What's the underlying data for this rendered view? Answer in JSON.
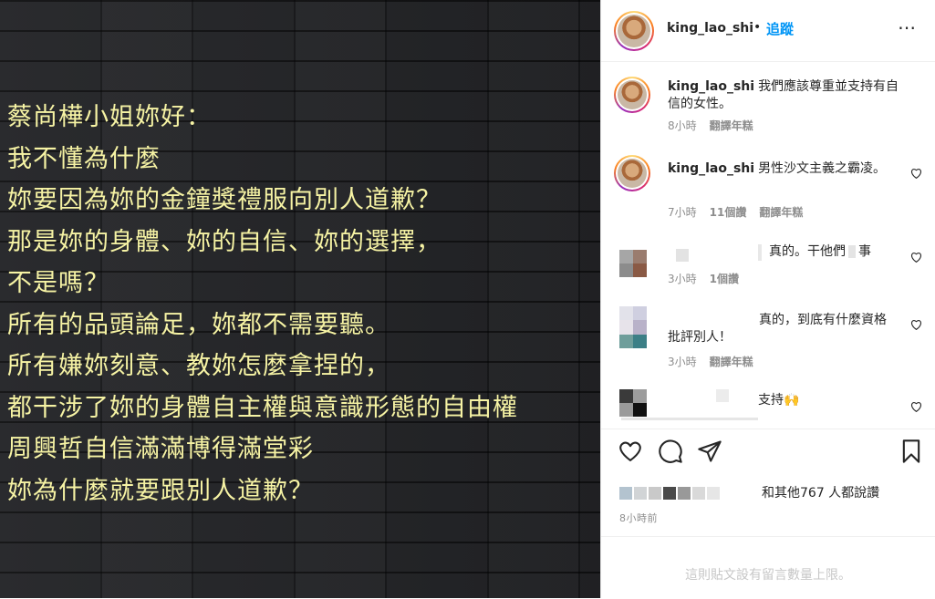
{
  "post_image": {
    "lines": [
      "蔡尚樺小姐妳好：",
      "我不懂為什麼",
      "妳要因為妳的金鐘獎禮服向別人道歉？",
      "那是妳的身體、妳的自信、妳的選擇，",
      "不是嗎？",
      "所有的品頭論足，妳都不需要聽。",
      "所有嫌妳刻意、教妳怎麼拿捏的，",
      "都干涉了妳的身體自主權與意識形態的自由權",
      "周興哲自信滿滿博得滿堂彩",
      "妳為什麼就要跟別人道歉？"
    ],
    "text_color": "#f6f3a4",
    "background": "dark wood planks"
  },
  "header": {
    "username": "king_lao_shi",
    "separator": "•",
    "follow_label": "追蹤",
    "more_icon": "⋯"
  },
  "comments": [
    {
      "username": "king_lao_shi",
      "text": "我們應該尊重並支持有自信的女性。",
      "time": "8小時",
      "translate": "翻譯年糕"
    },
    {
      "username": "king_lao_shi",
      "text": "男性沙文主義之霸凌。",
      "time": "7小時",
      "replies": "11個讚",
      "translate": "翻譯年糕"
    },
    {
      "text": "真的。干他們",
      "text_end": "事",
      "time": "3小時",
      "replies": "1個讚"
    },
    {
      "text": "真的，到底有什麼資格批評別人！",
      "time": "3小時",
      "translate": "翻譯年糕"
    },
    {
      "text": "支持🙌"
    }
  ],
  "likes": {
    "text": "和其他767 人都說讚"
  },
  "post_time": "8小時前",
  "comment_limit": "這則貼文設有留言數量上限。",
  "colors": {
    "accent": "#0095f6",
    "muted": "#8e8e8e",
    "text": "#262626"
  }
}
